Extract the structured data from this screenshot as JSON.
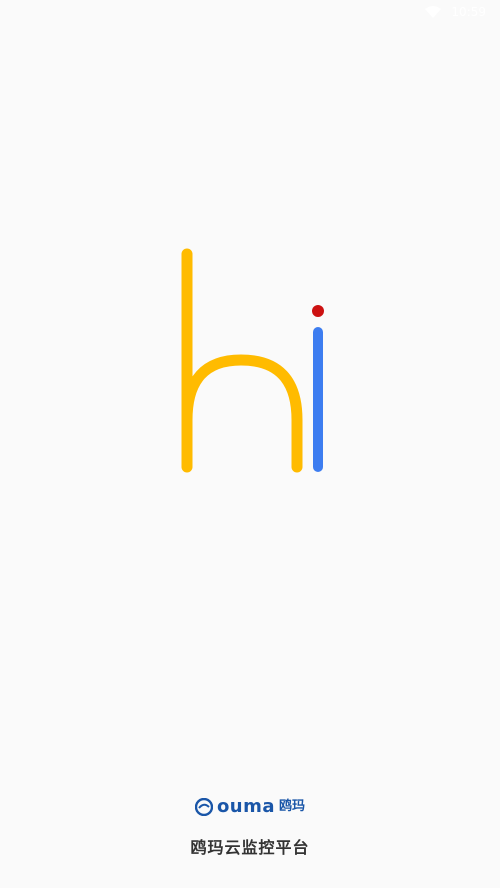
{
  "status_bar": {
    "time": "10:59",
    "icons": [
      "wifi-icon"
    ]
  },
  "splash": {
    "logo": {
      "text": "hi",
      "colors": {
        "h": "#ffbb00",
        "i_stem": "#3d7df0",
        "i_dot": "#cc1111"
      }
    }
  },
  "footer": {
    "brand": {
      "latin": "ouma",
      "chinese": "鸥玛",
      "color": "#1a56a8"
    },
    "platform_name": "鸥玛云监控平台"
  }
}
